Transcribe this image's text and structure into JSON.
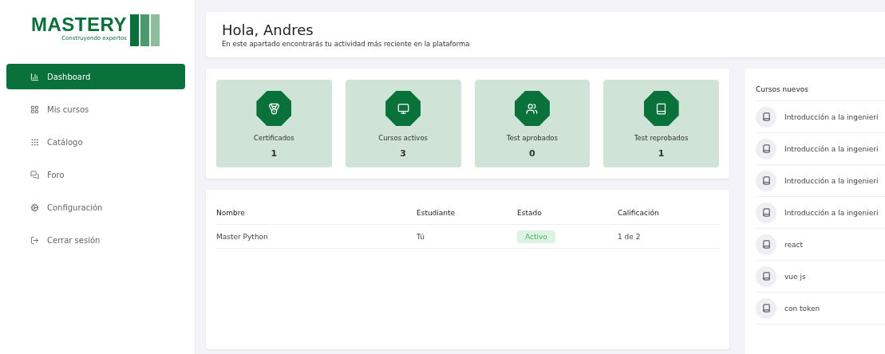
{
  "logo": {
    "name": "MASTERY",
    "tagline": "Construyendo expertos"
  },
  "nav": [
    {
      "label": "Dashboard",
      "selected": true
    },
    {
      "label": "Mis cursos",
      "selected": false
    },
    {
      "label": "Catálogo",
      "selected": false
    },
    {
      "label": "Foro",
      "selected": false
    },
    {
      "label": "Configuración",
      "selected": false
    },
    {
      "label": "Cerrar sesión",
      "selected": false
    }
  ],
  "header": {
    "title": "Hola, Andres",
    "subtitle": "En este apartado encontrarás tu actividad más reciente en la plataforma"
  },
  "stats": [
    {
      "label": "Certificados",
      "value": "1"
    },
    {
      "label": "Cursos activos",
      "value": "3"
    },
    {
      "label": "Test aprobados",
      "value": "0"
    },
    {
      "label": "Test reprobados",
      "value": "1"
    }
  ],
  "table": {
    "columns": [
      "Nombre",
      "Estudiante",
      "Estado",
      "Calificación"
    ],
    "rows": [
      {
        "name": "Master Python",
        "student": "Tú",
        "status": "Activo",
        "grade": "1 de 2"
      }
    ]
  },
  "new_courses": {
    "title": "Cursos nuevos",
    "items": [
      "Introducción a la ingenieri",
      "Introducción a la ingenieri",
      "Introducción a la ingenieri",
      "Introducción a la ingenieri",
      "react",
      "vue js",
      "con token"
    ]
  }
}
